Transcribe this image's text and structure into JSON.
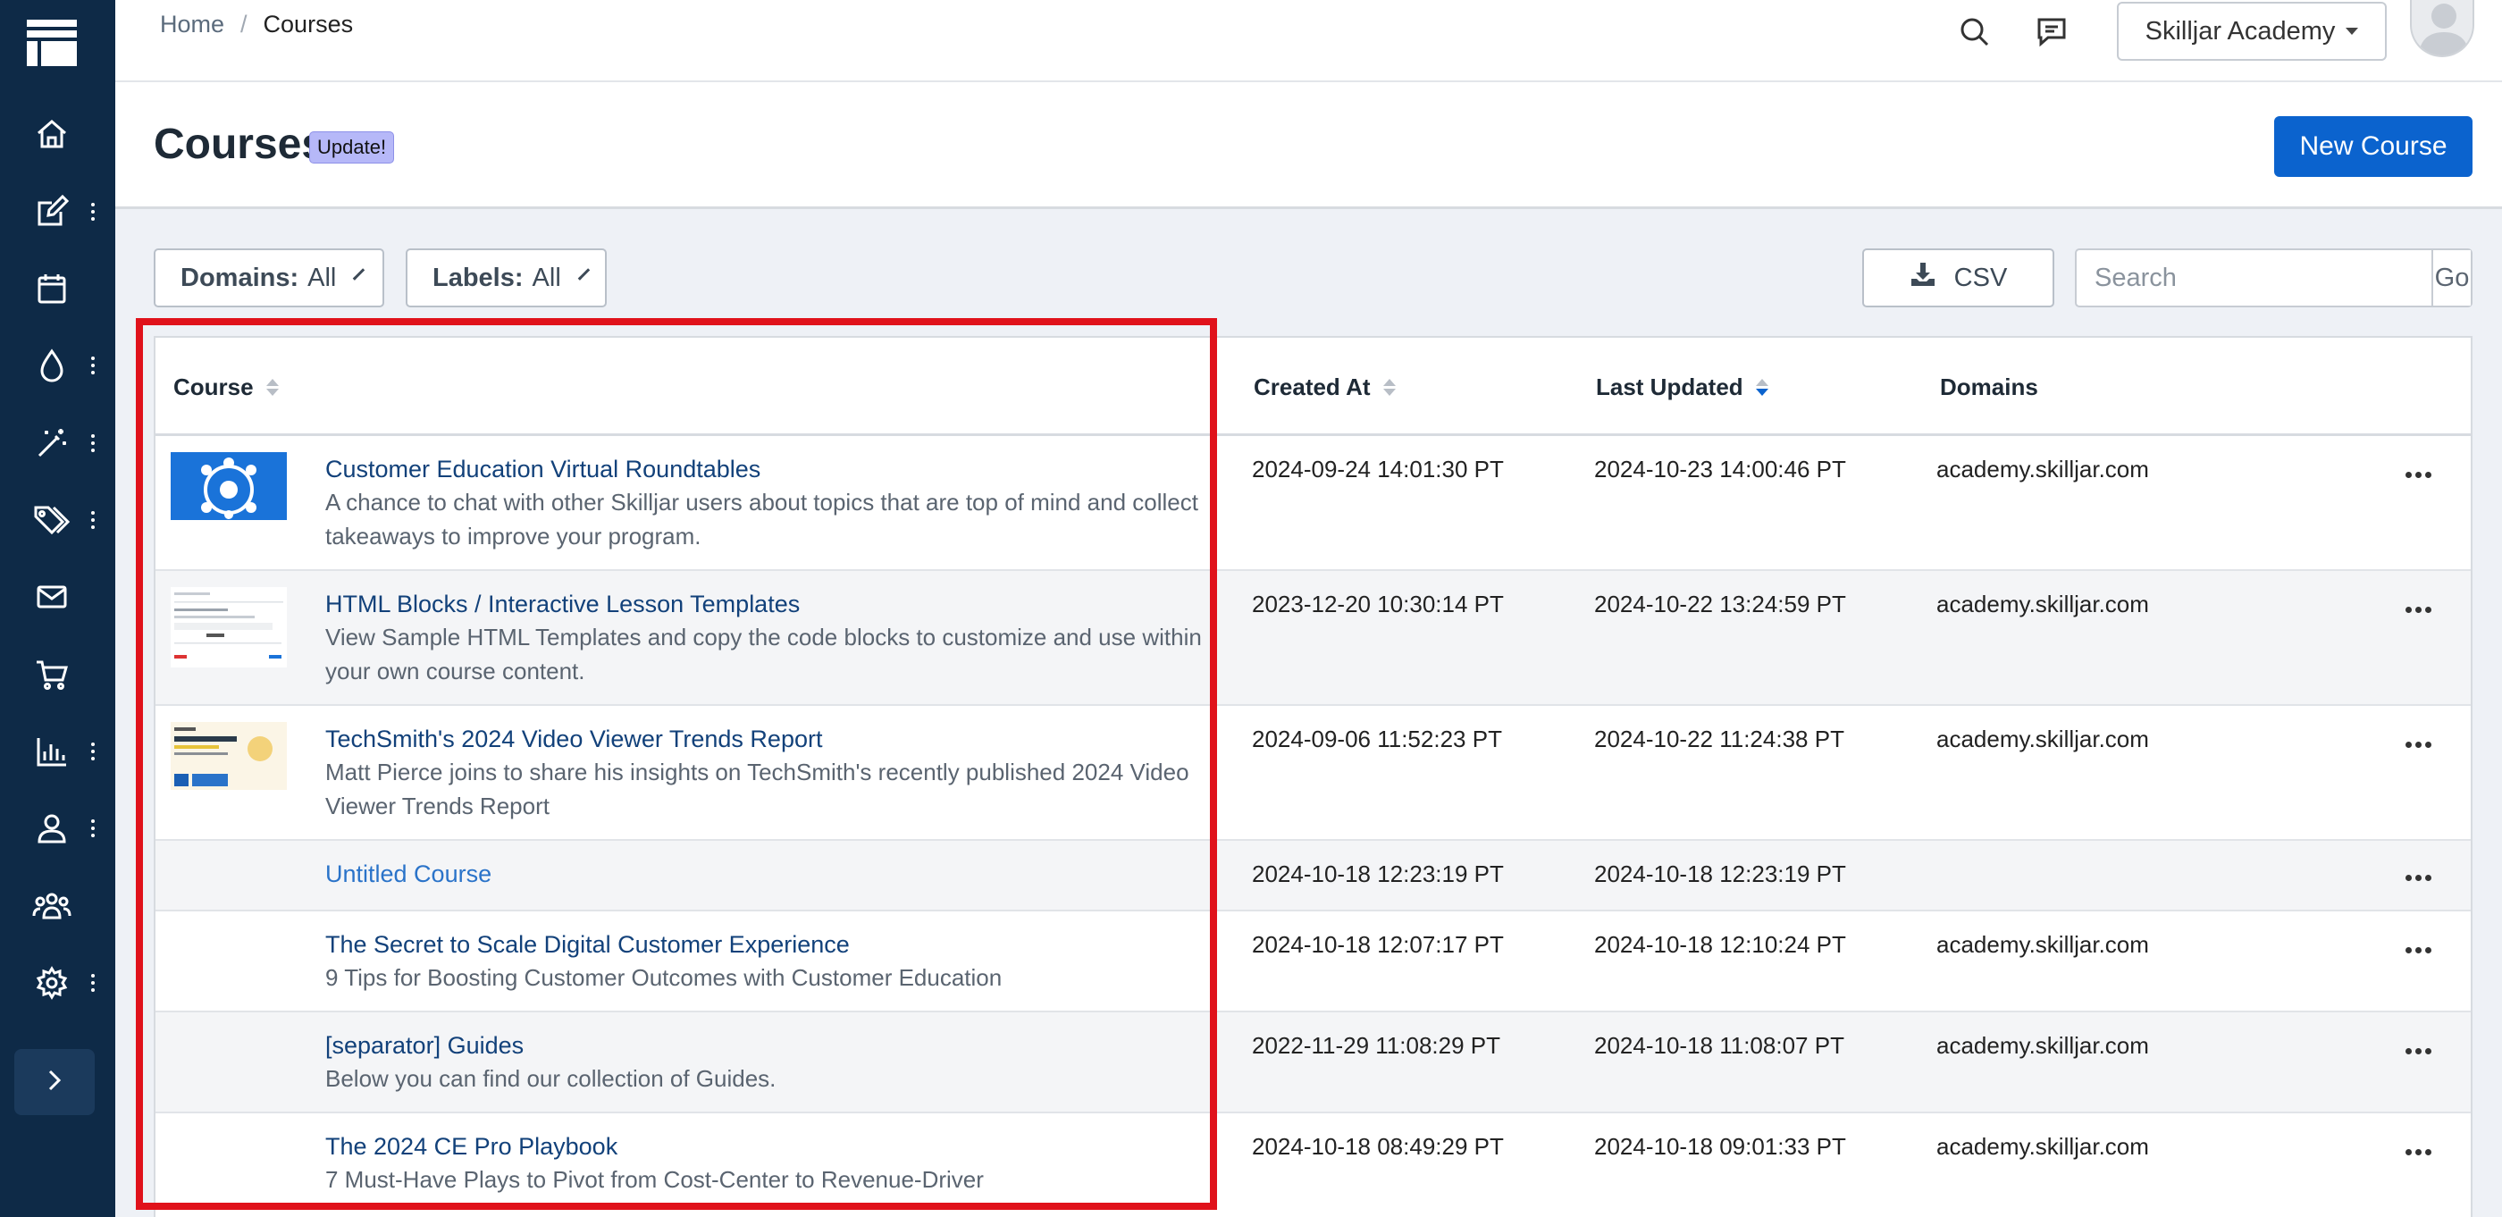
{
  "breadcrumb": {
    "home": "Home",
    "separator": "/",
    "current": "Courses"
  },
  "topbar": {
    "org_selector": "Skilljar Academy"
  },
  "header": {
    "title": "Courses",
    "badge": "Update!",
    "new_course_label": "New Course"
  },
  "filters": {
    "domains": {
      "label": "Domains:",
      "value": "All"
    },
    "labels": {
      "label": "Labels:",
      "value": "All"
    },
    "csv_label": "CSV",
    "search_placeholder": "Search",
    "go_label": "Go"
  },
  "table": {
    "columns": {
      "course": "Course",
      "created_at": "Created At",
      "last_updated": "Last Updated",
      "domains": "Domains"
    },
    "rows": [
      {
        "title": "Customer Education Virtual Roundtables",
        "desc": "A chance to chat with other Skilljar users about topics that are top of mind and collect takeaways to improve your program.",
        "created": "2024-09-24 14:01:30 PT",
        "updated": "2024-10-23 14:00:46 PT",
        "domain": "academy.skilljar.com",
        "thumb": "roundtable-icon"
      },
      {
        "title": "HTML Blocks / Interactive Lesson Templates",
        "desc": "View Sample HTML Templates and copy the code blocks to customize and use within your own course content.",
        "created": "2023-12-20 10:30:14 PT",
        "updated": "2024-10-22 13:24:59 PT",
        "domain": "academy.skilljar.com",
        "thumb": "template-screenshot"
      },
      {
        "title": "TechSmith's 2024 Video Viewer Trends Report",
        "desc": "Matt Pierce joins to share his insights on TechSmith's recently published 2024 Video Viewer Trends Report",
        "created": "2024-09-06 11:52:23 PT",
        "updated": "2024-10-22 11:24:38 PT",
        "domain": "academy.skilljar.com",
        "thumb": "report-screenshot"
      },
      {
        "title": "Untitled Course",
        "desc": "",
        "created": "2024-10-18 12:23:19 PT",
        "updated": "2024-10-18 12:23:19 PT",
        "domain": ""
      },
      {
        "title": "The Secret to Scale Digital Customer Experience",
        "desc": "9 Tips for Boosting Customer Outcomes with Customer Education",
        "created": "2024-10-18 12:07:17 PT",
        "updated": "2024-10-18 12:10:24 PT",
        "domain": "academy.skilljar.com"
      },
      {
        "title": "[separator] Guides",
        "desc": "Below you can find our collection of Guides.",
        "created": "2022-11-29 11:08:29 PT",
        "updated": "2024-10-18 11:08:07 PT",
        "domain": "academy.skilljar.com"
      },
      {
        "title": "The 2024 CE Pro Playbook",
        "desc": "7 Must-Have Plays to Pivot from Cost-Center to Revenue-Driver",
        "created": "2024-10-18 08:49:29 PT",
        "updated": "2024-10-18 09:01:33 PT",
        "domain": "academy.skilljar.com"
      }
    ]
  },
  "colors": {
    "sidebar": "#0e2a47",
    "primary": "#0b63ce",
    "highlight": "#e0121b",
    "badge": "#b6b8f8"
  }
}
